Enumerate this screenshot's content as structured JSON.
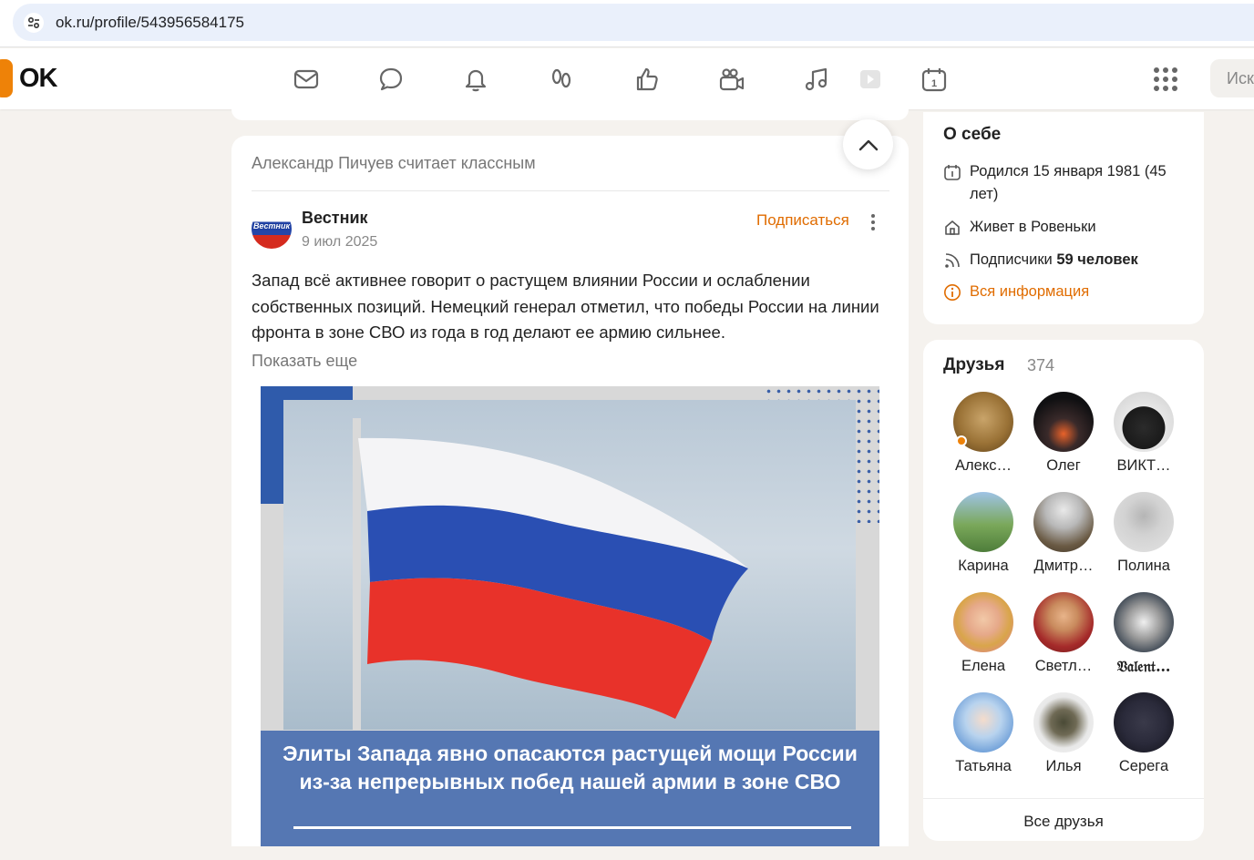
{
  "browser": {
    "url": "ok.ru/profile/543956584175"
  },
  "header": {
    "logo_text": "OK",
    "nav_icons": [
      "mail-icon",
      "chat-icon",
      "bell-icon",
      "guests-icon",
      "like-icon",
      "video-camera-icon",
      "music-icon",
      "play-icon",
      "calendar-icon"
    ],
    "calendar_day": "1",
    "search_placeholder": "Иск"
  },
  "feed": {
    "liked_by": "Александр Пичуев считает классным",
    "post": {
      "author": "Вестник",
      "avatar_text": "Вестник",
      "date": "9 июл 2025",
      "subscribe_label": "Подписаться",
      "text": "Запад всё активнее говорит о растущем влиянии России и ослаблении собственных позиций. Немецкий генерал отметил, что победы России на линии фронта в зоне СВО из года в год делают ее армию сильнее.",
      "show_more": "Показать еще",
      "image_caption": "Элиты Запада явно опасаются растущей мощи России из-за непрерывных побед нашей армии в зоне СВО"
    }
  },
  "about": {
    "title": "О себе",
    "born": "Родился 15 января 1981 (45 лет)",
    "lives_prefix": "Живет в",
    "lives_city": "Ровеньки",
    "subscribers_label": "Подписчики",
    "subscribers_value": "59 человек",
    "all_info": "Вся информация"
  },
  "friends": {
    "title": "Друзья",
    "count": "374",
    "items": [
      {
        "name": "Алекс…"
      },
      {
        "name": "Олег"
      },
      {
        "name": "ВИКТ…"
      },
      {
        "name": "Карина"
      },
      {
        "name": "Дмитр…"
      },
      {
        "name": "Полина"
      },
      {
        "name": "Елена"
      },
      {
        "name": "Светл…"
      },
      {
        "name": "𝔙𝔞𝔩𝔢𝔫𝔱…"
      },
      {
        "name": "Татьяна"
      },
      {
        "name": "Илья"
      },
      {
        "name": "Серега"
      }
    ],
    "all_friends": "Все друзья"
  }
}
